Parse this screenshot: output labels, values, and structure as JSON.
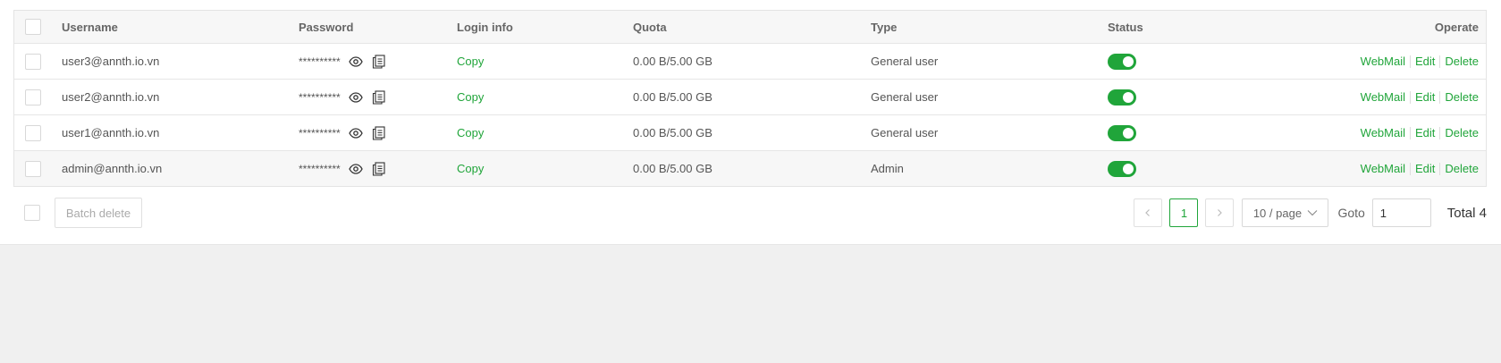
{
  "table": {
    "headers": {
      "username": "Username",
      "password": "Password",
      "login_info": "Login info",
      "quota": "Quota",
      "type": "Type",
      "status": "Status",
      "operate": "Operate"
    },
    "rows": [
      {
        "username": "user3@annth.io.vn",
        "password": "**********",
        "login": "Copy",
        "quota": "0.00 B/5.00 GB",
        "type": "General user",
        "status_on": true
      },
      {
        "username": "user2@annth.io.vn",
        "password": "**********",
        "login": "Copy",
        "quota": "0.00 B/5.00 GB",
        "type": "General user",
        "status_on": true
      },
      {
        "username": "user1@annth.io.vn",
        "password": "**********",
        "login": "Copy",
        "quota": "0.00 B/5.00 GB",
        "type": "General user",
        "status_on": true
      },
      {
        "username": "admin@annth.io.vn",
        "password": "**********",
        "login": "Copy",
        "quota": "0.00 B/5.00 GB",
        "type": "Admin",
        "status_on": true
      }
    ],
    "actions": {
      "webmail": "WebMail",
      "edit": "Edit",
      "delete": "Delete"
    }
  },
  "footer": {
    "batch_delete": "Batch delete",
    "current_page": "1",
    "page_size": "10 / page",
    "goto_label": "Goto",
    "goto_value": "1",
    "total": "Total 4"
  },
  "colors": {
    "accent": "#20a53a"
  },
  "icons": [
    "eye-icon",
    "copy-icon",
    "chevron-left-icon",
    "chevron-right-icon",
    "chevron-down-icon"
  ]
}
